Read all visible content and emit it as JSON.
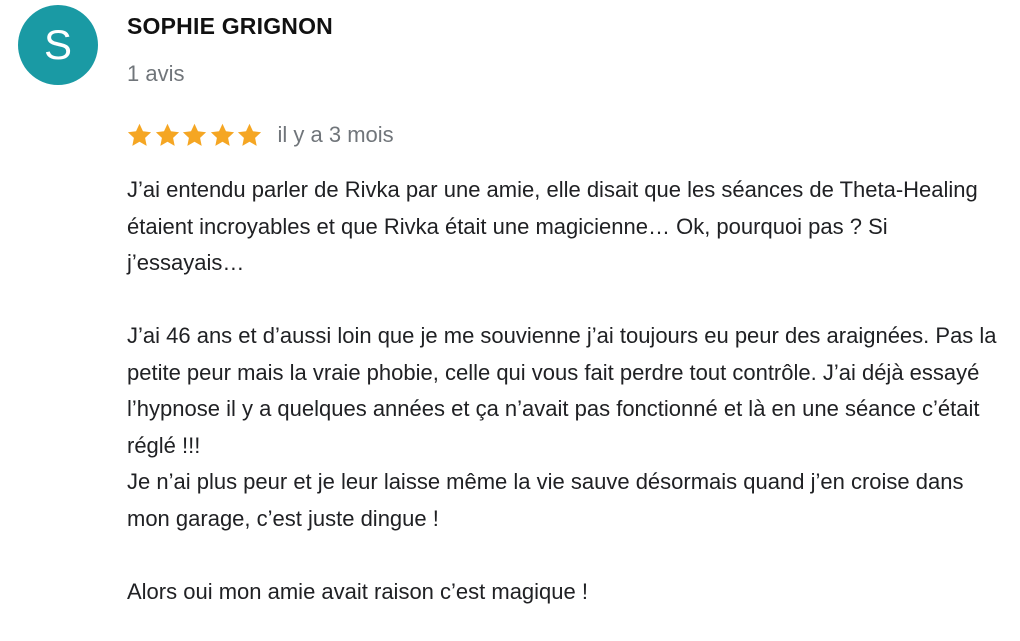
{
  "reviewer": {
    "avatar_letter": "S",
    "avatar_color": "#1a9aa4",
    "name": "SOPHIE GRIGNON",
    "review_count": "1 avis"
  },
  "review": {
    "rating": 5,
    "rating_max": 5,
    "star_color": "#f5a623",
    "date": "il y a 3 mois",
    "paragraphs": [
      "J’ai entendu parler de Rivka par une amie, elle disait que les séances de Theta-Healing étaient incroyables et que Rivka était une magicienne… Ok, pourquoi pas ? Si j’essayais…",
      "J’ai 46 ans et d’aussi loin que je me souvienne j’ai toujours eu peur des araignées. Pas la petite peur mais la vraie phobie, celle qui vous fait perdre tout contrôle. J’ai déjà essayé l’hypnose il y a quelques années et ça n’avait pas fonctionné et là en une séance c’était réglé !!!",
      "Je n’ai plus peur et je leur laisse même la vie sauve désormais quand j’en croise dans mon garage, c’est juste dingue !",
      "Alors oui mon amie avait raison c’est magique !"
    ]
  }
}
